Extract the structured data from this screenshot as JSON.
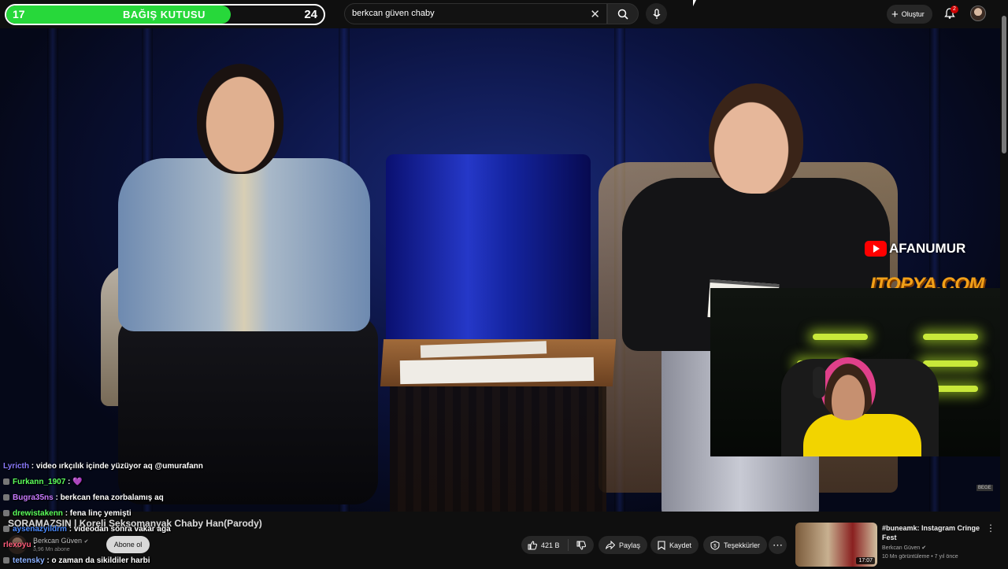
{
  "donation": {
    "current": "17",
    "label": "BAĞIŞ KUTUSU",
    "goal": "24",
    "progress": 0.708,
    "color": "#27d83a"
  },
  "search": {
    "value": "berkcan güven chaby",
    "placeholder": "Ara"
  },
  "header": {
    "create_label": "Oluştur",
    "notif_count": "2"
  },
  "watermarks": {
    "channel": "AFANUMUR",
    "sponsor": "ITOPYA.COM",
    "corner": "BEGE"
  },
  "chat": [
    {
      "user": "Lyricth",
      "color": "#8a7aff",
      "badge": false,
      "message": ": video ırkçılık içinde yüzüyor aq @umurafann"
    },
    {
      "user": "Furkann_1907",
      "color": "#5cff5c",
      "badge": true,
      "message": ": 💜"
    },
    {
      "user": "Bugra35ns",
      "color": "#c87aff",
      "badge": true,
      "message": ": berkcan fena zorbalamış aq"
    },
    {
      "user": "drewistakenn",
      "color": "#5cff5c",
      "badge": true,
      "message": ": fena linç yemişti"
    },
    {
      "user": "aysenazyildrm",
      "color": "#4a8aff",
      "badge": true,
      "message": ": videodan sonra vakar aga"
    },
    {
      "user": "rlexoyu",
      "color": "#ff5c7a",
      "badge": false,
      "message": ":"
    },
    {
      "user": "tetensky",
      "color": "#8ab0ff",
      "badge": true,
      "message": ": o zaman da sikildiler harbi"
    }
  ],
  "video": {
    "title": "SORAMAZSIN | Koreli Seksomanyak Chaby Han(Parody)",
    "channel": "Berkcan Güven",
    "subscribers": "3,96 Mn abone",
    "subscribe_label": "Abone ol",
    "likes": "421 B",
    "share_label": "Paylaş",
    "save_label": "Kaydet",
    "thanks_label": "Teşekkürler"
  },
  "recommendation": {
    "title": "#buneamk: Instagram Cringe Fest",
    "channel": "Berkcan Güven",
    "meta": "10 Mn görüntüleme • 7 yıl önce",
    "duration": "17:07"
  }
}
